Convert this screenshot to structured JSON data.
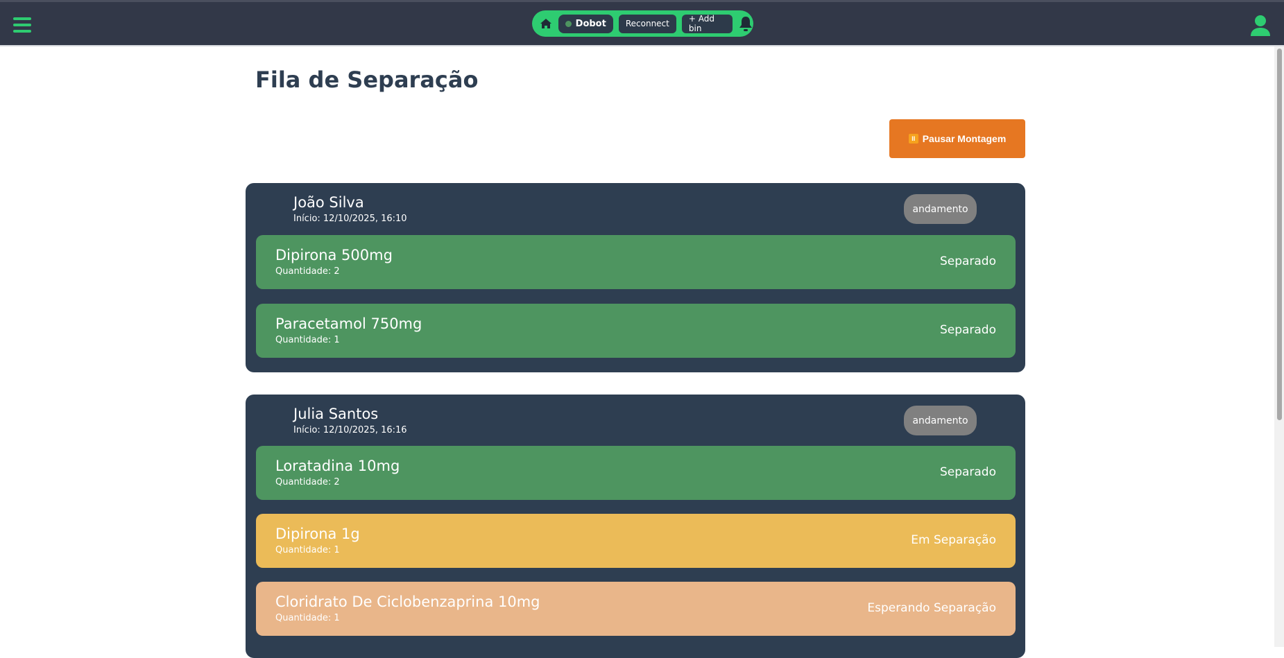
{
  "nav": {
    "device": "Dobot",
    "reconnect": "Reconnect",
    "add_bin": "+ Add bin"
  },
  "page": {
    "title": "Fila de Separação",
    "pause_label": "Pausar Montagem"
  },
  "colors": {
    "separado": "#4e9560",
    "em_separacao": "#ebbb58",
    "esperando": "#e9b68a",
    "card": "#2e3e51",
    "accent": "#2ecc71",
    "pause": "#e67722"
  },
  "orders": [
    {
      "name": "João Silva",
      "start": "Início: 12/10/2025, 16:10",
      "status": "andamento",
      "items": [
        {
          "name": "Dipirona 500mg",
          "qty": "Quantidade: 2",
          "status": "Separado"
        },
        {
          "name": "Paracetamol 750mg",
          "qty": "Quantidade: 1",
          "status": "Separado"
        }
      ]
    },
    {
      "name": "Julia Santos",
      "start": "Início: 12/10/2025, 16:16",
      "status": "andamento",
      "items": [
        {
          "name": "Loratadina 10mg",
          "qty": "Quantidade: 2",
          "status": "Separado"
        },
        {
          "name": "Dipirona 1g",
          "qty": "Quantidade: 1",
          "status": "Em Separação"
        },
        {
          "name": "Cloridrato De Ciclobenzaprina 10mg",
          "qty": "Quantidade: 1",
          "status": "Esperando Separação"
        }
      ]
    }
  ]
}
